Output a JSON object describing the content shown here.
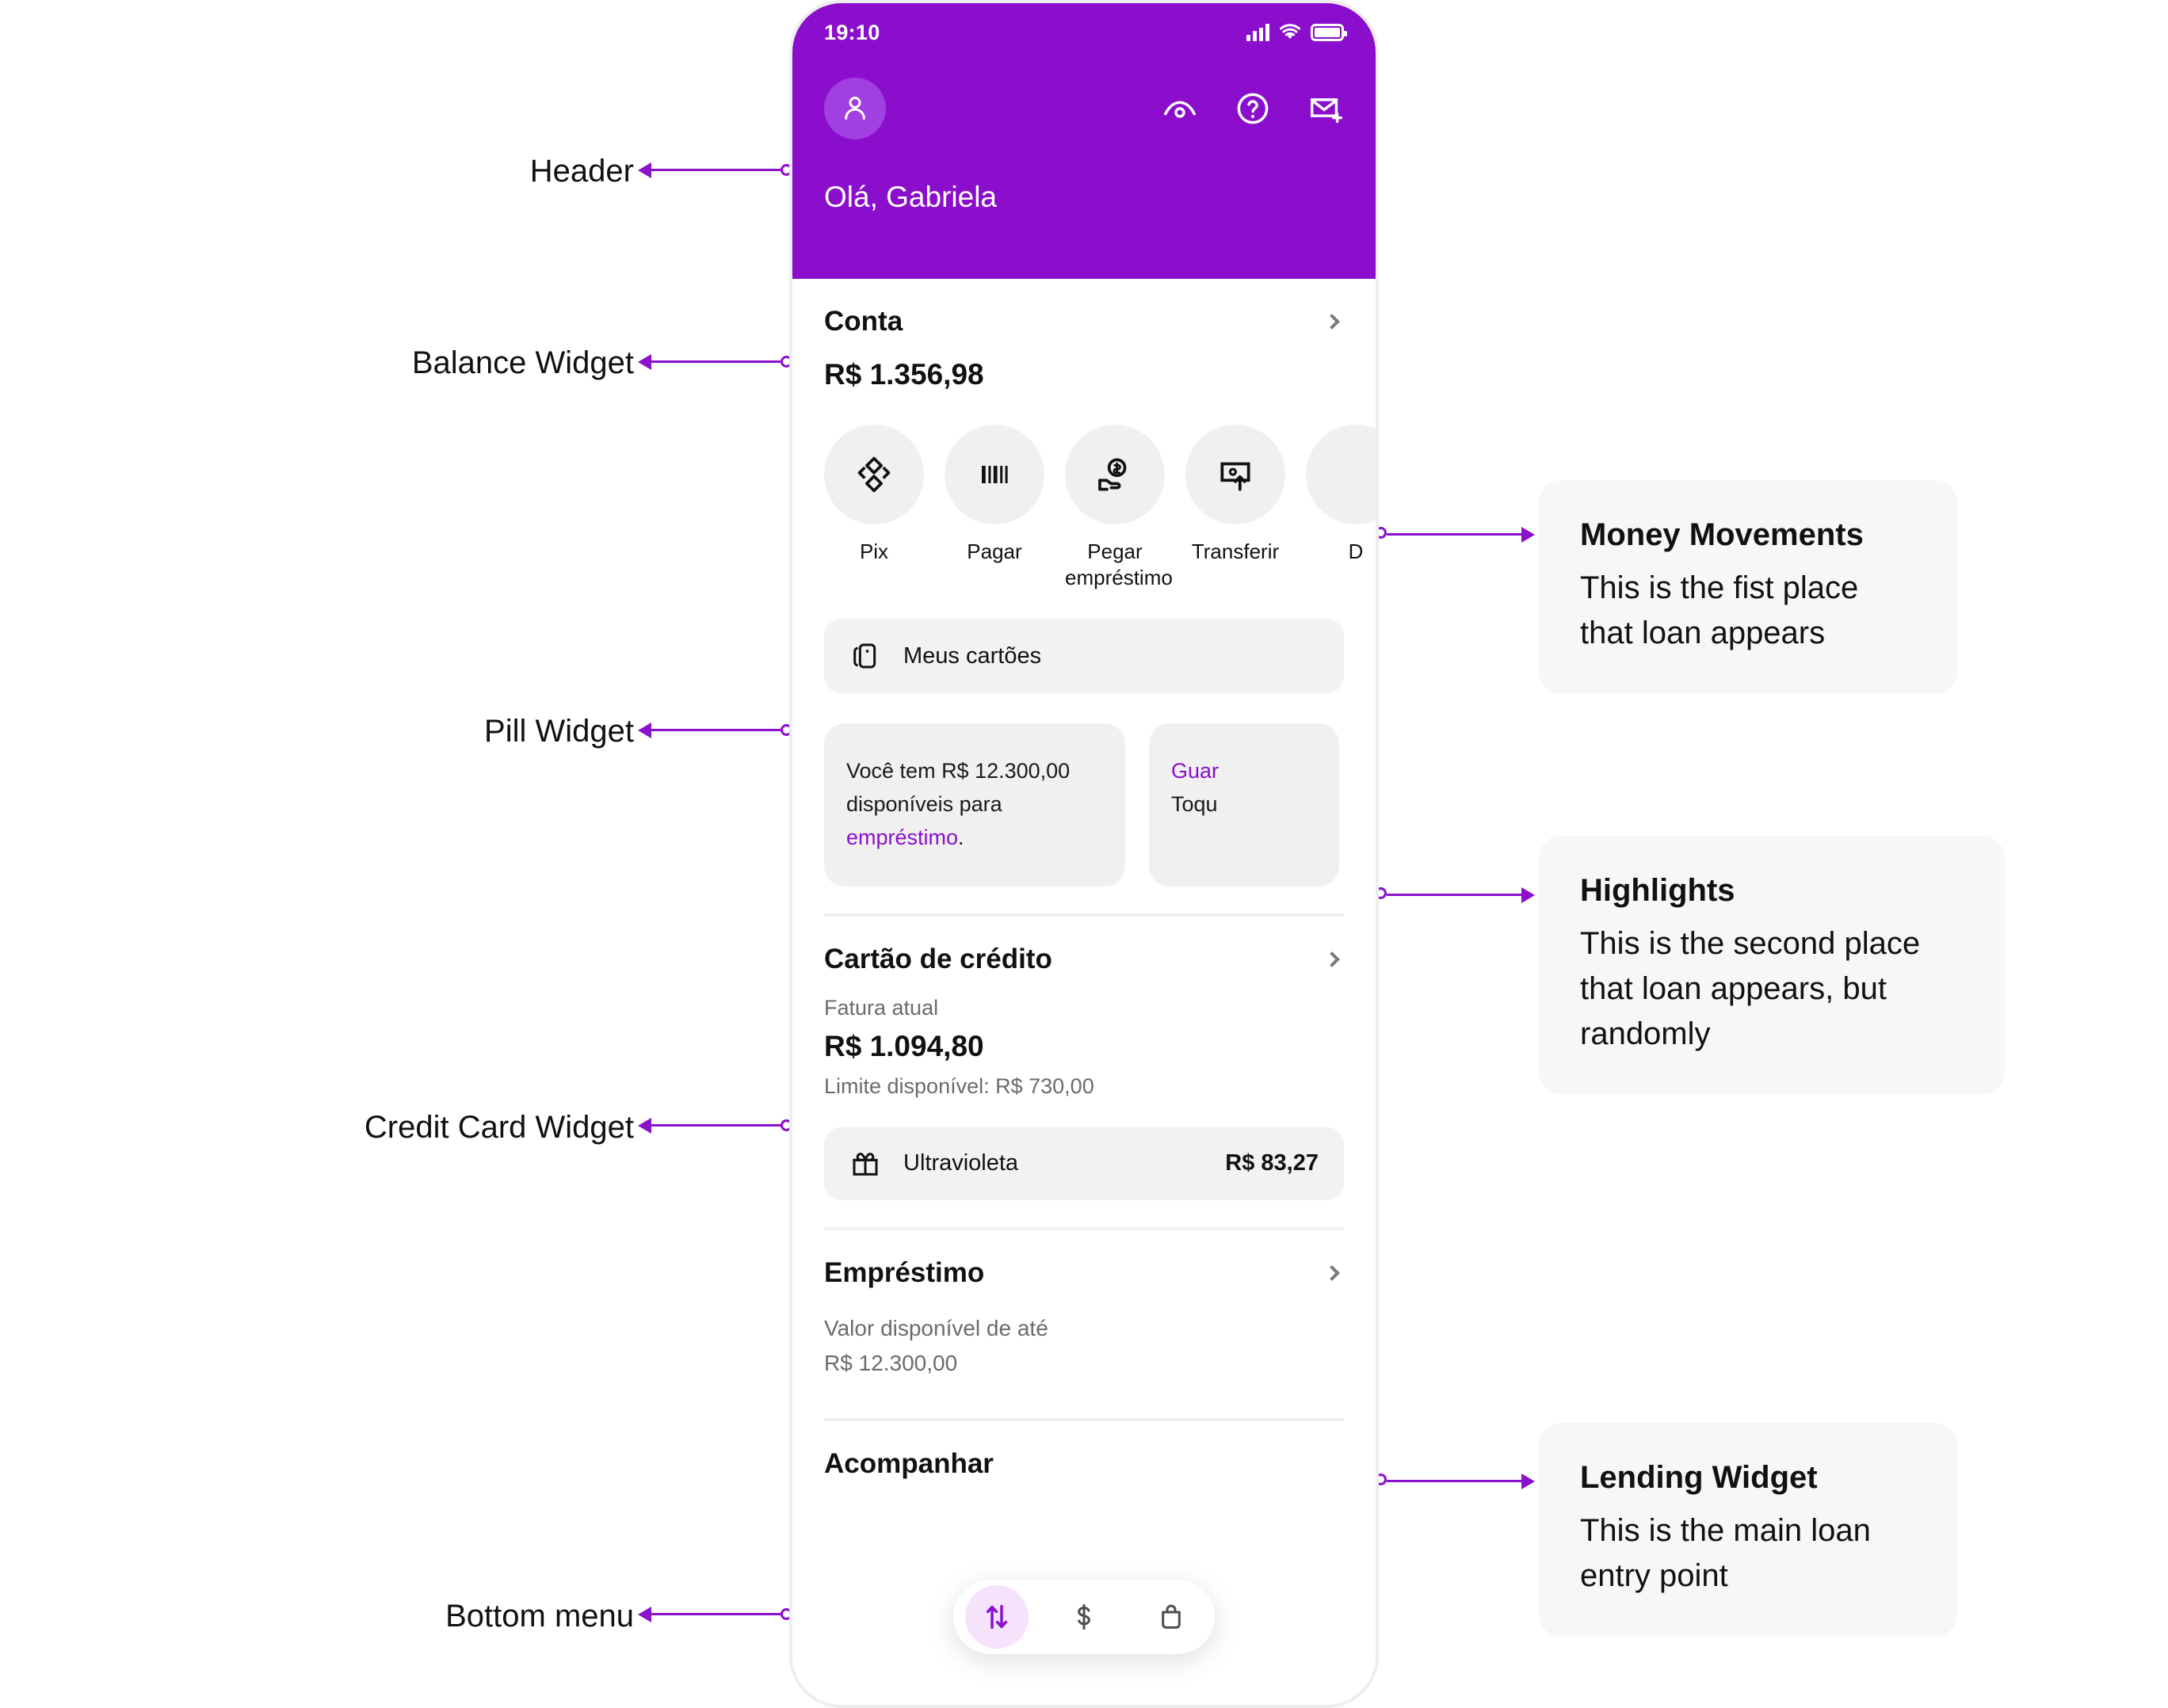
{
  "accent": "#8A0ECC",
  "annotation_color": "#8B11CC",
  "left_labels": [
    {
      "text": "Header"
    },
    {
      "text": "Balance Widget"
    },
    {
      "text": "Pill Widget"
    },
    {
      "text": "Credit Card Widget"
    },
    {
      "text": "Bottom menu"
    }
  ],
  "right_cards": [
    {
      "title": "Money Movements",
      "body": "This is the fist place that loan appears"
    },
    {
      "title": "Highlights",
      "body": "This is the second place that loan appears, but randomly"
    },
    {
      "title": "Lending Widget",
      "body": "This is the main loan entry point"
    }
  ],
  "phone": {
    "statusbar": {
      "time": "19:10",
      "signal_icon": "cellular-signal-icon",
      "wifi_icon": "wifi-icon",
      "battery_icon": "battery-icon"
    },
    "header": {
      "avatar_icon": "person-avatar-icon",
      "icons": [
        {
          "name": "eye-icon"
        },
        {
          "name": "help-question-icon"
        },
        {
          "name": "mail-plus-icon"
        }
      ],
      "greeting": "Olá, Gabriela"
    },
    "account": {
      "title": "Conta",
      "chevron_icon": "chevron-right-icon",
      "balance": "R$ 1.356,98",
      "actions": [
        {
          "label": "Pix",
          "icon": "pix-diamond-icon"
        },
        {
          "label": "Pagar",
          "icon": "barcode-icon"
        },
        {
          "label": "Pegar empréstimo",
          "icon": "hand-money-icon"
        },
        {
          "label": "Transferir",
          "icon": "transfer-up-icon"
        },
        {
          "label": "D",
          "icon": "deposit-icon"
        }
      ]
    },
    "pill": {
      "label": "Meus cartões",
      "icon": "cards-icon"
    },
    "highlights": [
      {
        "text_before": "Você tem R$ 12.300,00 disponíveis para ",
        "link": "empréstimo",
        "text_after": "."
      },
      {
        "title": "Guar",
        "sub": "Toqu"
      }
    ],
    "credit_card": {
      "title": "Cartão de crédito",
      "chevron_icon": "chevron-right-icon",
      "subtitle": "Fatura atual",
      "amount": "R$ 1.094,80",
      "limit": "Limite disponível: R$ 730,00",
      "reward": {
        "icon": "gift-icon",
        "name": "Ultravioleta",
        "value": "R$ 83,27"
      }
    },
    "loan": {
      "title": "Empréstimo",
      "chevron_icon": "chevron-right-icon",
      "subtitle_line1": "Valor disponível de até",
      "subtitle_line2": "R$ 12.300,00"
    },
    "bottom": {
      "section_title": "Acompanhar",
      "nav": [
        {
          "name": "transactions-icon",
          "active": true
        },
        {
          "name": "dollar-icon",
          "active": false
        },
        {
          "name": "shopping-bag-icon",
          "active": false
        }
      ]
    }
  }
}
